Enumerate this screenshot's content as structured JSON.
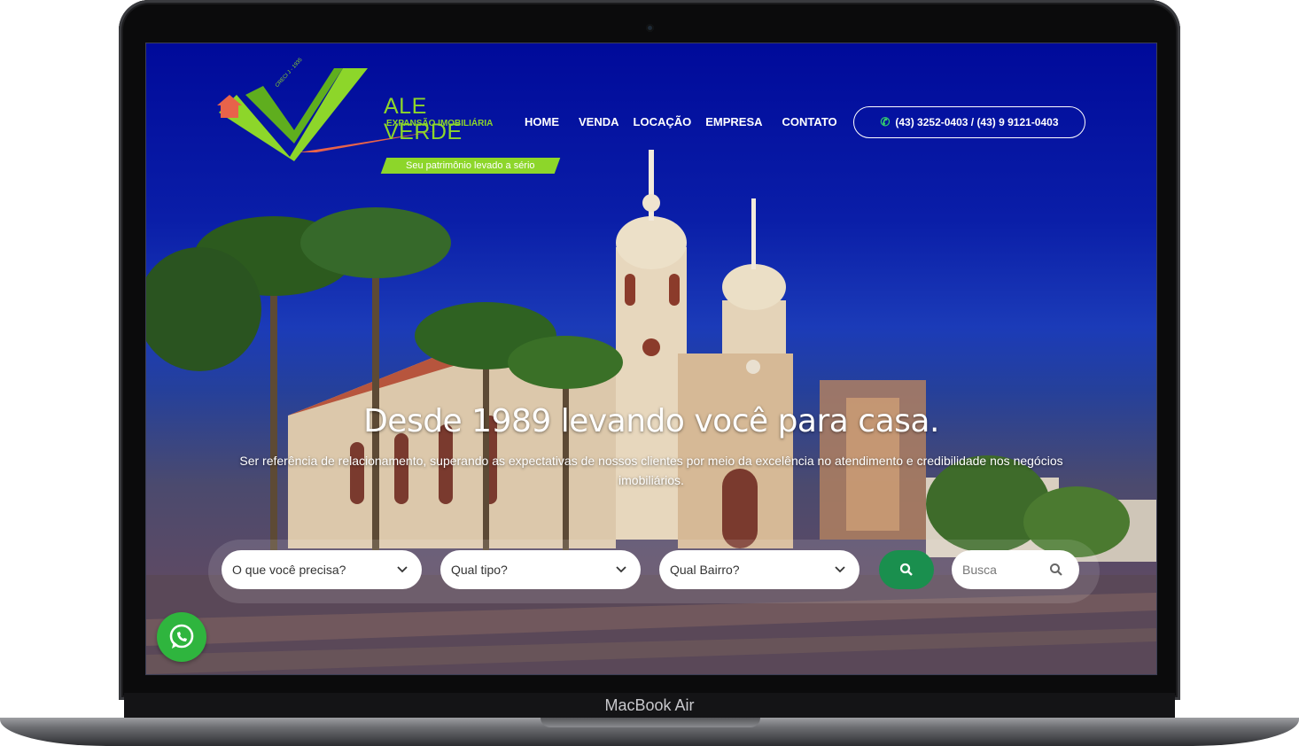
{
  "device": {
    "model_label": "MacBook Air"
  },
  "logo": {
    "title": "ALE VERDE",
    "subtitle": "EXPANSÃO IMOBILIÁRIA",
    "tagline": "Seu patrimônio levado a sério",
    "seal": "CRECI J - 1935",
    "brand_green": "#8dd62a",
    "accent_orange": "#e8634a"
  },
  "nav": {
    "items": [
      "HOME",
      "VENDA",
      "LOCAÇÃO",
      "EMPRESA",
      "CONTATO"
    ]
  },
  "header": {
    "phone_label": "(43) 3252-0403 / (43) 9 9121-0403",
    "phone_icon": "phone-icon"
  },
  "hero": {
    "title": "Desde 1989 levando você para casa.",
    "subtitle": "Ser referência de relacionamento, superando as expectativas de nossos clientes por meio da excelência no atendimento e credibilidade nos negócios imobiliários."
  },
  "search": {
    "need_select": "O que você precisa?",
    "type_select": "Qual tipo?",
    "neighborhood_select": "Qual Bairro?",
    "keyword_placeholder": "Busca",
    "button_icon": "search-icon",
    "button_color": "#1a8f4e"
  },
  "whatsapp": {
    "icon": "whatsapp-icon",
    "color": "#2fb53e"
  }
}
